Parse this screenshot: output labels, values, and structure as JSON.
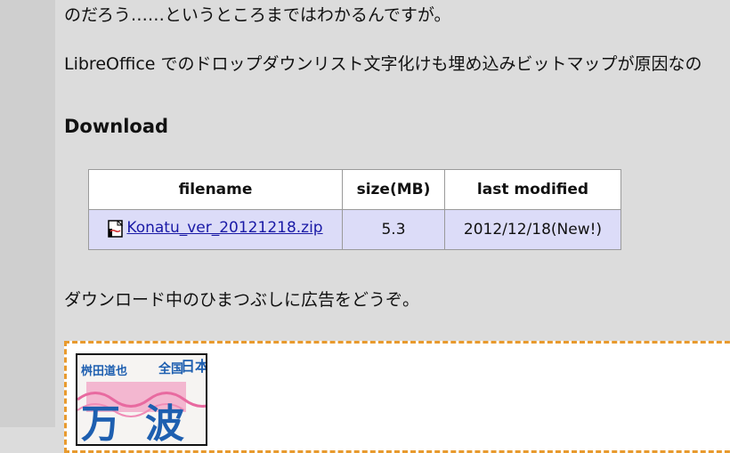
{
  "paragraphs": {
    "p1": "のだろう……というところまではわかるんですが。",
    "p2": "LibreOffice でのドロップダウンリスト文字化けも埋め込みビットマップが原因なの",
    "p3": "ダウンロード中のひまつぶしに広告をどうぞ。"
  },
  "download": {
    "heading": "Download",
    "columns": [
      "filename",
      "size(MB)",
      "last modified"
    ],
    "rows": [
      {
        "filename": "Konatu_ver_20121218.zip",
        "size": "5.3",
        "modified": "2012/12/18(New!)"
      }
    ]
  },
  "ad": {
    "cover_text": {
      "author": "桝田道也",
      "nihon": "日本",
      "zenkoku": "全国",
      "char1": "万",
      "char2": "波"
    }
  },
  "colors": {
    "page_bg": "#dcdcdc",
    "left_strip": "#cfcfcf",
    "table_header_bg": "#ffffff",
    "table_row_bg": "#dcdcf8",
    "link": "#1a1aa6",
    "ad_border": "#e89a2e"
  },
  "icons": [
    "zip-file-icon"
  ]
}
